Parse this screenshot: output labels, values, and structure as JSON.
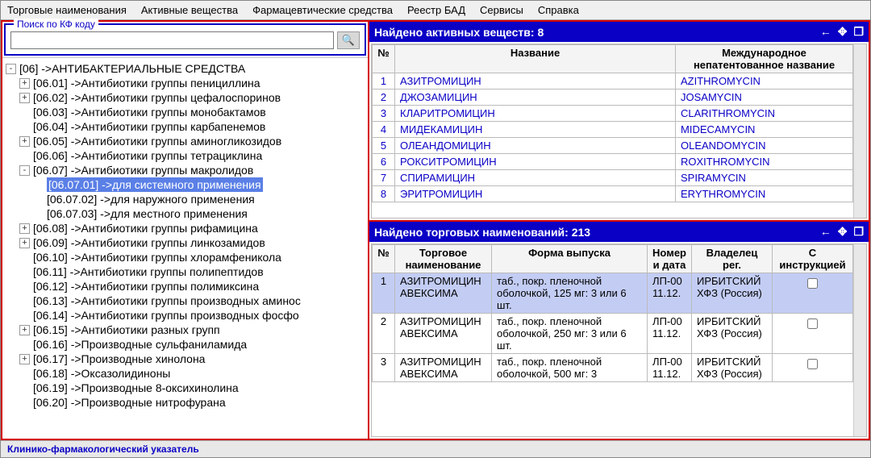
{
  "menu": [
    "Торговые наименования",
    "Активные вещества",
    "Фармацевтические средства",
    "Реестр БАД",
    "Сервисы",
    "Справка"
  ],
  "search": {
    "legend": "Поиск по КФ коду",
    "value": "",
    "placeholder": ""
  },
  "tree": {
    "root": "[06] ->АНТИБАКТЕРИАЛЬНЫЕ СРЕДСТВА",
    "children": [
      {
        "exp": "+",
        "text": "[06.01] ->Антибиотики группы пенициллина"
      },
      {
        "exp": "+",
        "text": "[06.02] ->Антибиотики группы цефалоспоринов"
      },
      {
        "exp": "",
        "text": "[06.03] ->Антибиотики группы монобактамов"
      },
      {
        "exp": "",
        "text": "[06.04] ->Антибиотики группы карбапенемов"
      },
      {
        "exp": "+",
        "text": "[06.05] ->Антибиотики группы аминогликозидов"
      },
      {
        "exp": "",
        "text": "[06.06] ->Антибиотики группы тетрациклина"
      },
      {
        "exp": "-",
        "text": "[06.07] ->Антибиотики группы макролидов",
        "children": [
          {
            "text": "[06.07.01] ->для системного применения",
            "selected": true
          },
          {
            "text": "[06.07.02] ->для наружного применения"
          },
          {
            "text": "[06.07.03] ->для местного применения"
          }
        ]
      },
      {
        "exp": "+",
        "text": "[06.08] ->Антибиотики группы рифамицина"
      },
      {
        "exp": "+",
        "text": "[06.09] ->Антибиотики группы линкозамидов"
      },
      {
        "exp": "",
        "text": "[06.10] ->Антибиотики группы хлорамфеникола"
      },
      {
        "exp": "",
        "text": "[06.11] ->Антибиотики группы полипептидов"
      },
      {
        "exp": "",
        "text": "[06.12] ->Антибиотики группы полимиксина"
      },
      {
        "exp": "",
        "text": "[06.13] ->Антибиотики группы производных аминос"
      },
      {
        "exp": "",
        "text": "[06.14] ->Антибиотики группы производных фосфо"
      },
      {
        "exp": "+",
        "text": "[06.15] ->Антибиотики разных групп"
      },
      {
        "exp": "",
        "text": "[06.16] ->Производные сульфаниламида"
      },
      {
        "exp": "+",
        "text": "[06.17] ->Производные хинолона"
      },
      {
        "exp": "",
        "text": "[06.18] ->Оксазолидиноны"
      },
      {
        "exp": "",
        "text": "[06.19] ->Производные 8-оксихинолина"
      },
      {
        "exp": "",
        "text": "[06.20] ->Производные нитрофурана"
      }
    ]
  },
  "active": {
    "title": "Найдено активных веществ: 8",
    "cols": {
      "num": "№",
      "name": "Название",
      "inn": "Международное непатентованное название"
    },
    "rows": [
      {
        "n": "1",
        "name": "АЗИТРОМИЦИН",
        "inn": "AZITHROMYCIN"
      },
      {
        "n": "2",
        "name": "ДЖОЗАМИЦИН",
        "inn": "JOSAMYCIN"
      },
      {
        "n": "3",
        "name": "КЛАРИТРОМИЦИН",
        "inn": "CLARITHROMYCIN"
      },
      {
        "n": "4",
        "name": "МИДЕКАМИЦИН",
        "inn": "MIDECAMYCIN"
      },
      {
        "n": "5",
        "name": "ОЛЕАНДОМИЦИН",
        "inn": "OLEANDOMYCIN"
      },
      {
        "n": "6",
        "name": "РОКСИТРОМИЦИН",
        "inn": "ROXITHROMYCIN"
      },
      {
        "n": "7",
        "name": "СПИРАМИЦИН",
        "inn": "SPIRAMYCIN"
      },
      {
        "n": "8",
        "name": "ЭРИТРОМИЦИН",
        "inn": "ERYTHROMYCIN"
      }
    ]
  },
  "trade": {
    "title": "Найдено торговых наименований: 213",
    "cols": {
      "num": "№",
      "name": "Торговое наименование",
      "form": "Форма выпуска",
      "regnum": "Номер и дата",
      "owner": "Владелец рег.",
      "instr": "С инструкцией"
    },
    "rows": [
      {
        "n": "1",
        "name": "АЗИТРОМИЦИН АВЕКСИМА",
        "form": "таб., покр. пленочной оболочкой, 125 мг: 3 или 6 шт.",
        "regnum": "ЛП-00 11.12.",
        "owner": "ИРБИТСКИЙ ХФЗ (Россия)",
        "selected": true
      },
      {
        "n": "2",
        "name": "АЗИТРОМИЦИН АВЕКСИМА",
        "form": "таб., покр. пленочной оболочкой, 250 мг: 3 или 6 шт.",
        "regnum": "ЛП-00 11.12.",
        "owner": "ИРБИТСКИЙ ХФЗ (Россия)"
      },
      {
        "n": "3",
        "name": "АЗИТРОМИЦИН АВЕКСИМА",
        "form": "таб., покр. пленочной оболочкой, 500 мг: 3",
        "regnum": "ЛП-00 11.12.",
        "owner": "ИРБИТСКИЙ ХФЗ (Россия)"
      }
    ]
  },
  "status": "Клинико-фармакологический указатель",
  "icons": {
    "back": "←",
    "move": "✥",
    "copy": "❐",
    "search": "🔍"
  }
}
